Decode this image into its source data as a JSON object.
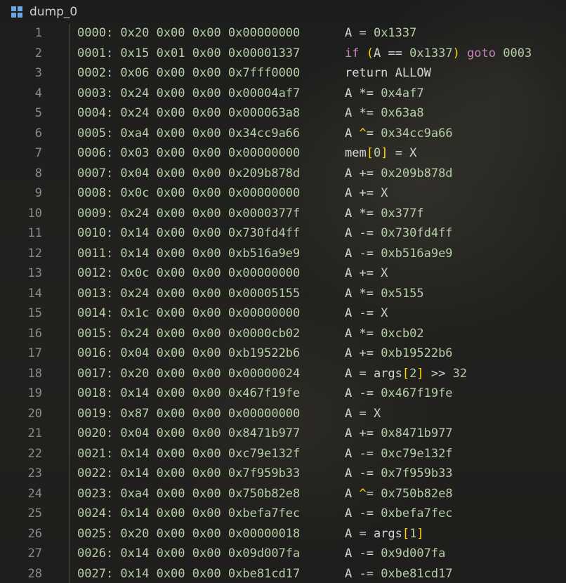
{
  "tab": {
    "title": "dump_0",
    "icon": "windows-icon"
  },
  "lines": [
    {
      "ln": "1",
      "hex": "0000: 0x20 0x00 0x00 0x00000000",
      "tokens": [
        [
          "A = ",
          "w"
        ],
        [
          "0x1337",
          "n"
        ]
      ]
    },
    {
      "ln": "2",
      "hex": "0001: 0x15 0x01 0x00 0x00001337",
      "tokens": [
        [
          "if ",
          "k"
        ],
        [
          "(",
          "p"
        ],
        [
          "A == ",
          "w"
        ],
        [
          "0x1337",
          "n"
        ],
        [
          ")",
          "p"
        ],
        [
          " goto ",
          "k"
        ],
        [
          "0003",
          "n"
        ]
      ]
    },
    {
      "ln": "3",
      "hex": "0002: 0x06 0x00 0x00 0x7fff0000",
      "tokens": [
        [
          "return ALLOW",
          "w"
        ]
      ]
    },
    {
      "ln": "4",
      "hex": "0003: 0x24 0x00 0x00 0x00004af7",
      "tokens": [
        [
          "A *= ",
          "w"
        ],
        [
          "0x4af7",
          "n"
        ]
      ]
    },
    {
      "ln": "5",
      "hex": "0004: 0x24 0x00 0x00 0x000063a8",
      "tokens": [
        [
          "A *= ",
          "w"
        ],
        [
          "0x63a8",
          "n"
        ]
      ]
    },
    {
      "ln": "6",
      "hex": "0005: 0xa4 0x00 0x00 0x34cc9a66",
      "tokens": [
        [
          "A ",
          "w"
        ],
        [
          "^",
          "p"
        ],
        [
          "= ",
          "w"
        ],
        [
          "0x34cc9a66",
          "n"
        ]
      ]
    },
    {
      "ln": "7",
      "hex": "0006: 0x03 0x00 0x00 0x00000000",
      "tokens": [
        [
          "mem",
          "w"
        ],
        [
          "[",
          "p"
        ],
        [
          "0",
          "n"
        ],
        [
          "]",
          "p"
        ],
        [
          " = X",
          "w"
        ]
      ]
    },
    {
      "ln": "8",
      "hex": "0007: 0x04 0x00 0x00 0x209b878d",
      "tokens": [
        [
          "A += ",
          "w"
        ],
        [
          "0x209b878d",
          "n"
        ]
      ]
    },
    {
      "ln": "9",
      "hex": "0008: 0x0c 0x00 0x00 0x00000000",
      "tokens": [
        [
          "A += X",
          "w"
        ]
      ]
    },
    {
      "ln": "10",
      "hex": "0009: 0x24 0x00 0x00 0x0000377f",
      "tokens": [
        [
          "A *= ",
          "w"
        ],
        [
          "0x377f",
          "n"
        ]
      ]
    },
    {
      "ln": "11",
      "hex": "0010: 0x14 0x00 0x00 0x730fd4ff",
      "tokens": [
        [
          "A -= ",
          "w"
        ],
        [
          "0x730fd4ff",
          "n"
        ]
      ]
    },
    {
      "ln": "12",
      "hex": "0011: 0x14 0x00 0x00 0xb516a9e9",
      "tokens": [
        [
          "A -= ",
          "w"
        ],
        [
          "0xb516a9e9",
          "n"
        ]
      ]
    },
    {
      "ln": "13",
      "hex": "0012: 0x0c 0x00 0x00 0x00000000",
      "tokens": [
        [
          "A += X",
          "w"
        ]
      ]
    },
    {
      "ln": "14",
      "hex": "0013: 0x24 0x00 0x00 0x00005155",
      "tokens": [
        [
          "A *= ",
          "w"
        ],
        [
          "0x5155",
          "n"
        ]
      ]
    },
    {
      "ln": "15",
      "hex": "0014: 0x1c 0x00 0x00 0x00000000",
      "tokens": [
        [
          "A -= X",
          "w"
        ]
      ]
    },
    {
      "ln": "16",
      "hex": "0015: 0x24 0x00 0x00 0x0000cb02",
      "tokens": [
        [
          "A *= ",
          "w"
        ],
        [
          "0xcb02",
          "n"
        ]
      ]
    },
    {
      "ln": "17",
      "hex": "0016: 0x04 0x00 0x00 0xb19522b6",
      "tokens": [
        [
          "A += ",
          "w"
        ],
        [
          "0xb19522b6",
          "n"
        ]
      ]
    },
    {
      "ln": "18",
      "hex": "0017: 0x20 0x00 0x00 0x00000024",
      "tokens": [
        [
          "A = args",
          "w"
        ],
        [
          "[",
          "p"
        ],
        [
          "2",
          "n"
        ],
        [
          "]",
          "p"
        ],
        [
          " >> ",
          "w"
        ],
        [
          "32",
          "n"
        ]
      ]
    },
    {
      "ln": "19",
      "hex": "0018: 0x14 0x00 0x00 0x467f19fe",
      "tokens": [
        [
          "A -= ",
          "w"
        ],
        [
          "0x467f19fe",
          "n"
        ]
      ]
    },
    {
      "ln": "20",
      "hex": "0019: 0x87 0x00 0x00 0x00000000",
      "tokens": [
        [
          "A = X",
          "w"
        ]
      ]
    },
    {
      "ln": "21",
      "hex": "0020: 0x04 0x00 0x00 0x8471b977",
      "tokens": [
        [
          "A += ",
          "w"
        ],
        [
          "0x8471b977",
          "n"
        ]
      ]
    },
    {
      "ln": "22",
      "hex": "0021: 0x14 0x00 0x00 0xc79e132f",
      "tokens": [
        [
          "A -= ",
          "w"
        ],
        [
          "0xc79e132f",
          "n"
        ]
      ]
    },
    {
      "ln": "23",
      "hex": "0022: 0x14 0x00 0x00 0x7f959b33",
      "tokens": [
        [
          "A -= ",
          "w"
        ],
        [
          "0x7f959b33",
          "n"
        ]
      ]
    },
    {
      "ln": "24",
      "hex": "0023: 0xa4 0x00 0x00 0x750b82e8",
      "tokens": [
        [
          "A ",
          "w"
        ],
        [
          "^",
          "p"
        ],
        [
          "= ",
          "w"
        ],
        [
          "0x750b82e8",
          "n"
        ]
      ]
    },
    {
      "ln": "25",
      "hex": "0024: 0x14 0x00 0x00 0xbefa7fec",
      "tokens": [
        [
          "A -= ",
          "w"
        ],
        [
          "0xbefa7fec",
          "n"
        ]
      ]
    },
    {
      "ln": "26",
      "hex": "0025: 0x20 0x00 0x00 0x00000018",
      "tokens": [
        [
          "A = args",
          "w"
        ],
        [
          "[",
          "p"
        ],
        [
          "1",
          "n"
        ],
        [
          "]",
          "p"
        ]
      ]
    },
    {
      "ln": "27",
      "hex": "0026: 0x14 0x00 0x00 0x09d007fa",
      "tokens": [
        [
          "A -= ",
          "w"
        ],
        [
          "0x9d007fa",
          "n"
        ]
      ]
    },
    {
      "ln": "28",
      "hex": "0027: 0x14 0x00 0x00 0xbe81cd17",
      "tokens": [
        [
          "A -= ",
          "w"
        ],
        [
          "0xbe81cd17",
          "n"
        ]
      ]
    }
  ],
  "colors": {
    "hex_text": "#b5cea8",
    "keyword": "#c586c0",
    "bracket": "#ffd700",
    "plain": "#d4d4d4",
    "line_number": "#8b8b8b"
  }
}
